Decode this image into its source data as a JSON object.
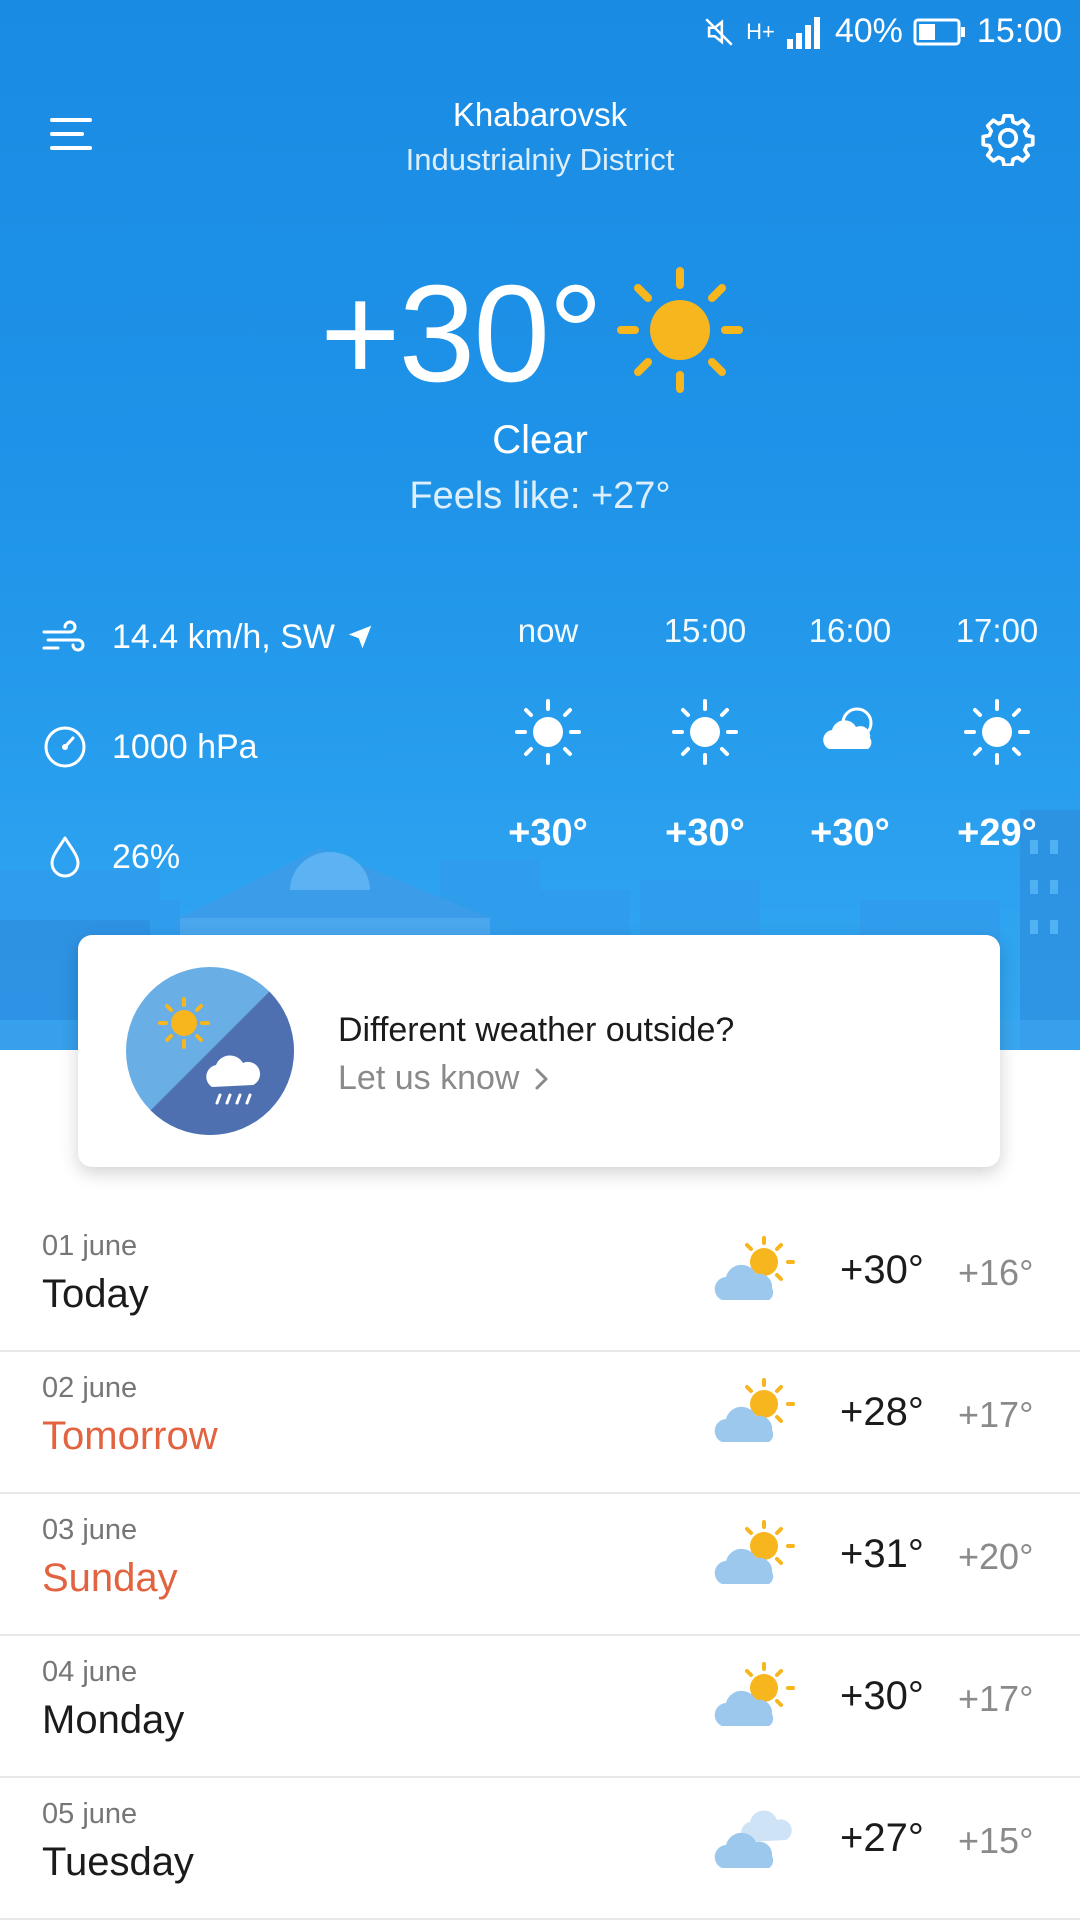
{
  "status_bar": {
    "battery": "40%",
    "time": "15:00",
    "network": "H+"
  },
  "header": {
    "city": "Khabarovsk",
    "district": "Industrialniy District"
  },
  "current": {
    "temp": "+30°",
    "condition": "Clear",
    "feels_like": "Feels like: +27°",
    "icon": "sun-icon"
  },
  "metrics": {
    "wind": "14.4 km/h, SW",
    "pressure": "1000 hPa",
    "humidity": "26%"
  },
  "hourly": [
    {
      "time": "now",
      "temp": "+30°",
      "icon": "sun-icon"
    },
    {
      "time": "15:00",
      "temp": "+30°",
      "icon": "sun-icon"
    },
    {
      "time": "16:00",
      "temp": "+30°",
      "icon": "cloud-icon"
    },
    {
      "time": "17:00",
      "temp": "+29°",
      "icon": "sun-icon"
    }
  ],
  "card": {
    "title": "Different weather outside?",
    "link": "Let us know"
  },
  "forecast": [
    {
      "date": "01 june",
      "day": "Today",
      "high": "+30°",
      "low": "+16°",
      "weekend": false,
      "icon": "partly-cloudy-icon"
    },
    {
      "date": "02 june",
      "day": "Tomorrow",
      "high": "+28°",
      "low": "+17°",
      "weekend": true,
      "icon": "partly-cloudy-icon"
    },
    {
      "date": "03 june",
      "day": "Sunday",
      "high": "+31°",
      "low": "+20°",
      "weekend": true,
      "icon": "partly-cloudy-icon"
    },
    {
      "date": "04 june",
      "day": "Monday",
      "high": "+30°",
      "low": "+17°",
      "weekend": false,
      "icon": "partly-cloudy-icon"
    },
    {
      "date": "05 june",
      "day": "Tuesday",
      "high": "+27°",
      "low": "+15°",
      "weekend": false,
      "icon": "cloudy-icon"
    }
  ],
  "colors": {
    "sky_top": "#1a8be3",
    "sky_bottom": "#35a8f1",
    "sun": "#f7b51e",
    "weekend": "#e1633f",
    "cloud": "#9cc8ee"
  }
}
